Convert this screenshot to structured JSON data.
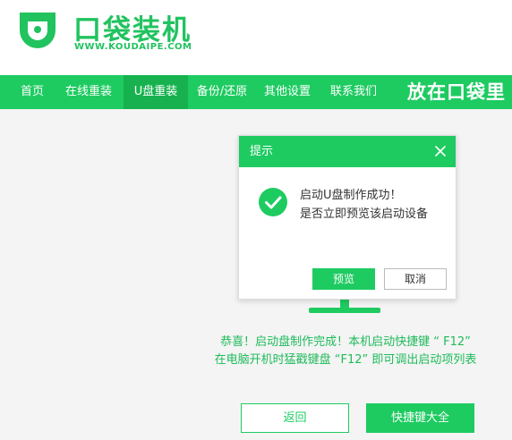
{
  "brand": {
    "name": "口袋装机",
    "url": "WWW.KOUDAIPE.COM"
  },
  "nav": {
    "items": [
      {
        "label": "首页"
      },
      {
        "label": "在线重装"
      },
      {
        "label": "U盘重装",
        "active": true
      },
      {
        "label": "备份/还原"
      },
      {
        "label": "其他设置"
      },
      {
        "label": "联系我们"
      }
    ],
    "slogan": "放在口袋里"
  },
  "dialog": {
    "title": "提示",
    "line1": "启动U盘制作成功！",
    "line2": "是否立即预览该启动设备",
    "preview_label": "预览",
    "cancel_label": "取消"
  },
  "message": {
    "line1": "恭喜！启动盘制作完成！本机启动快捷键 “ F12”",
    "line2": "在电脑开机时猛戳键盘 “F12” 即可调出启动项列表"
  },
  "actions": {
    "back_label": "返回",
    "shortcut_label": "快捷键大全"
  },
  "colors": {
    "accent": "#1ecb61",
    "accent_dark": "#17b24f",
    "text": "#333333"
  }
}
